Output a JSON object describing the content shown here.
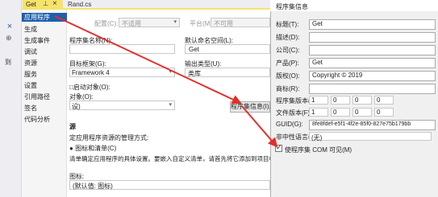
{
  "doc_tabs": [
    {
      "label": "Get",
      "pin": "⊥",
      "close": "×"
    },
    {
      "label": "Rand.cs"
    }
  ],
  "left_strip": {
    "close": "×",
    "pin": "⊕",
    "label": "到"
  },
  "nav": {
    "items": [
      {
        "label": "应用程序",
        "selected": true
      },
      {
        "label": "生成"
      },
      {
        "label": "生成事件"
      },
      {
        "label": "调试"
      },
      {
        "label": "资源"
      },
      {
        "label": "服务"
      },
      {
        "label": "设置"
      },
      {
        "label": "引用路径"
      },
      {
        "label": "签名"
      },
      {
        "label": "代码分析"
      }
    ]
  },
  "config_bar": {
    "config_label": "配置(C):",
    "config_value": "不适用",
    "platform_label": "平台(M):",
    "platform_value": "不可用"
  },
  "app_page": {
    "assembly_name_label": "程序集名称(N):",
    "assembly_name_value": "",
    "default_ns_label": "默认命名空间(L):",
    "default_ns_value": "Get",
    "target_fw_label": "目标框架(G):",
    "target_fw_value": "Framework 4",
    "output_type_label": "输出类型(U):",
    "output_type_value": "类库",
    "startup_label": "启动对象(O):",
    "startup_value": "设)",
    "startup_group_label": "对象(O):",
    "assembly_info_button": "程序集信息(I)...",
    "resources_heading": "源",
    "resources_desc": "定应用程序资源的管理方式:",
    "icon_manifest_label": "图标和清单(C)",
    "icon_manifest_desc": "清单确定应用程序的具体设置。要嵌入自定义清单，请首先将它添加到项目中，然后从下列",
    "icon_label": "图标:",
    "icon_value": "(默认值: 图标)"
  },
  "dialog": {
    "title": "程序集信息",
    "fields": [
      {
        "label": "标题(T):",
        "value": "Get"
      },
      {
        "label": "描述(D):",
        "value": ""
      },
      {
        "label": "公司(C):",
        "value": ""
      },
      {
        "label": "产品(P):",
        "value": "Get"
      },
      {
        "label": "版权(O):",
        "value": "Copyright © 2019"
      },
      {
        "label": "商标(R):",
        "value": ""
      }
    ],
    "assembly_version_label": "程序集版本(A):",
    "assembly_version": [
      "1",
      "0",
      "0",
      "0"
    ],
    "file_version_label": "文件版本(F):",
    "file_version": [
      "1",
      "0",
      "0",
      "0"
    ],
    "guid_label": "GUID(G):",
    "guid_value": "8fe8fdef-e5f1-4f2e-85f0-827e75b179bb",
    "neutral_lang_label": "非中性语言(N):",
    "neutral_lang_value": "(无)",
    "com_visible_label": "使程序集 COM 可见(M)",
    "com_visible_checked": true
  },
  "colors": {
    "accent": "#1e5fae",
    "arrow": "#e0302a",
    "tab_yellow": "#f6e36a",
    "nav_bg": "#f5f5f5"
  }
}
